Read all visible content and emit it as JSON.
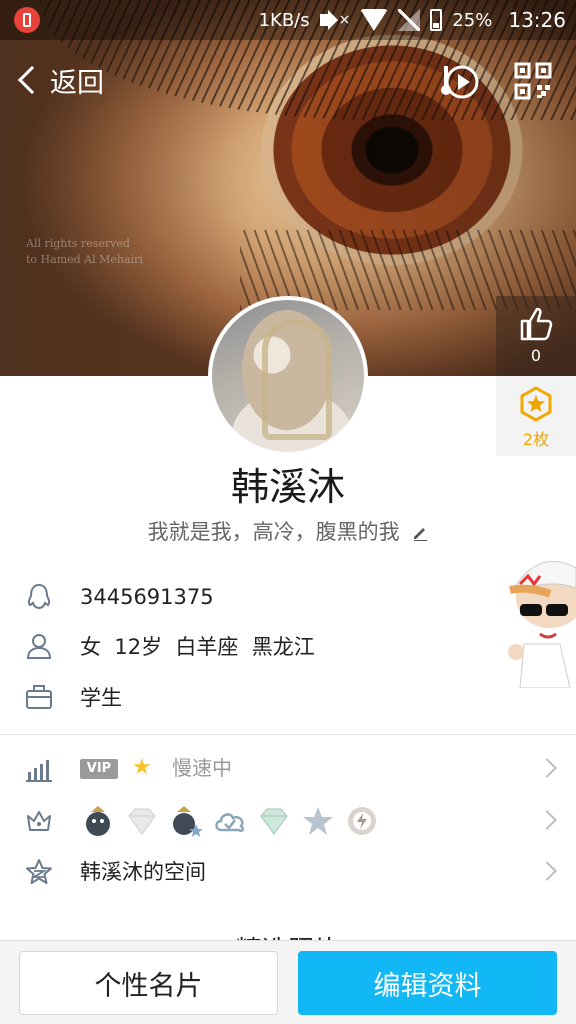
{
  "status_bar": {
    "speed": "1KB/s",
    "battery": "25%",
    "time": "13:26",
    "battery_level": 0.25
  },
  "nav": {
    "back_label": "返回"
  },
  "cover": {
    "watermark_line1": "All rights reserved",
    "watermark_line2": "to Hamed Al Mehairi"
  },
  "side": {
    "like_count": "0",
    "medal_count": "2枚"
  },
  "profile": {
    "name": "韩溪沐",
    "signature": "我就是我，高冷，腹黑的我"
  },
  "info": {
    "qq_number": "3445691375",
    "basic": "女  12岁  白羊座  黑龙江",
    "occupation": "学生"
  },
  "vip_row": {
    "badge": "VIP",
    "status": "慢速中"
  },
  "badges_row": {
    "icons": [
      "penguin-badge-icon",
      "diamond-badge-icon",
      "penguin-star-badge-icon",
      "cloud-badge-icon",
      "green-diamond-badge-icon",
      "star-badge-icon",
      "lightning-badge-icon"
    ]
  },
  "space_row": {
    "label": "韩溪沐的空间"
  },
  "featured": {
    "title": "精选照片"
  },
  "buttons": {
    "card_label": "个性名片",
    "edit_label": "编辑资料"
  },
  "colors": {
    "accent": "#12b7f5",
    "medal": "#f0a800"
  }
}
